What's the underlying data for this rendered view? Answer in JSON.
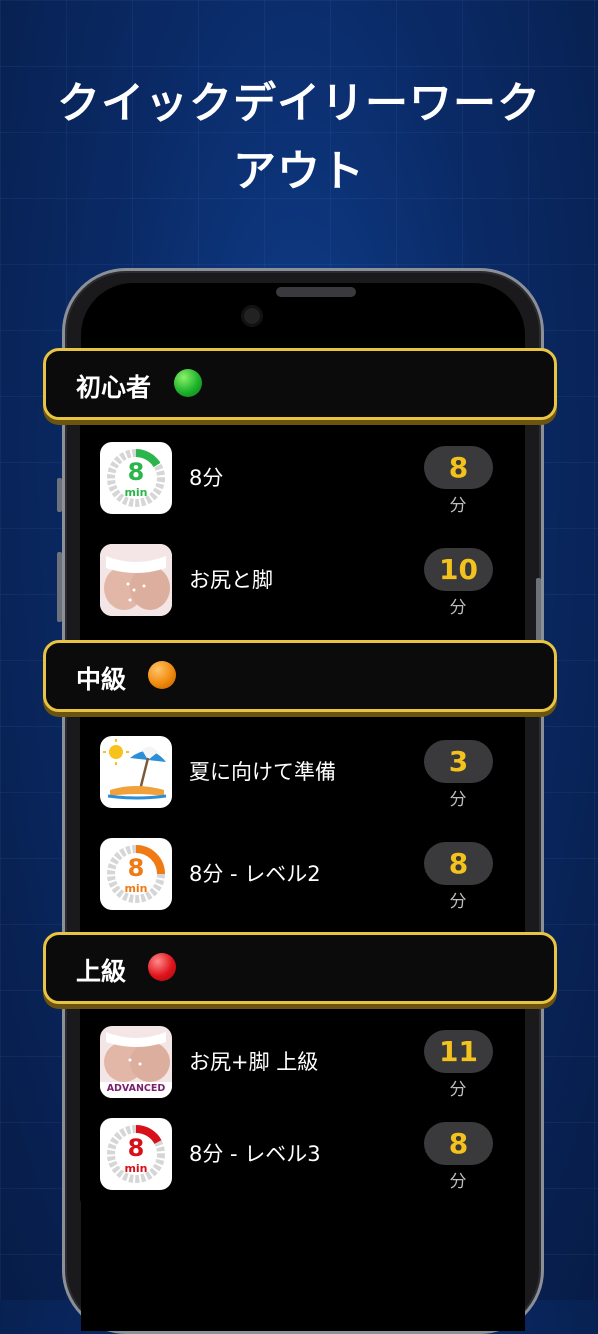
{
  "headline": {
    "line1": "クイックデイリーワーク",
    "line2": "アウト"
  },
  "levels": [
    {
      "label": "初心者",
      "dot_color": "#1db32b"
    },
    {
      "label": "中級",
      "dot_color": "#f08a0c"
    },
    {
      "label": "上級",
      "dot_color": "#e0141b"
    }
  ],
  "workouts": [
    {
      "label": "8分",
      "duration": "8",
      "unit": "分",
      "icon": "timer-icon",
      "timer_text": "8",
      "timer_unit": "min",
      "accent": "#2ab64a"
    },
    {
      "label": "お尻と脚",
      "duration": "10",
      "unit": "分",
      "icon": "glutes-icon"
    },
    {
      "label": "夏に向けて準備",
      "duration": "3",
      "unit": "分",
      "icon": "beach-icon"
    },
    {
      "label": "8分 - レベル2",
      "duration": "8",
      "unit": "分",
      "icon": "timer-icon",
      "timer_text": "8",
      "timer_unit": "min",
      "accent": "#f07a14"
    },
    {
      "label": "お尻+脚 上級",
      "duration": "11",
      "unit": "分",
      "icon": "glutes-advanced-icon",
      "badge": "ADVANCED"
    },
    {
      "label": "8分 - レベル3",
      "duration": "8",
      "unit": "分",
      "icon": "timer-icon",
      "timer_text": "8",
      "timer_unit": "min",
      "accent": "#d8101a"
    }
  ]
}
